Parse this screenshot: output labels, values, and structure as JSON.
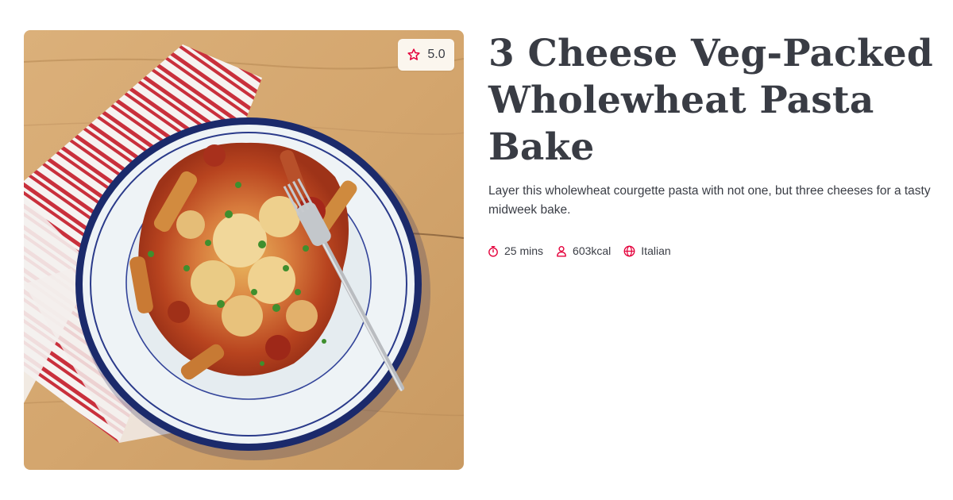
{
  "recipe": {
    "title": "3 Cheese Veg-Packed Wholewheat Pasta Bake",
    "description": "Layer this wholewheat courgette pasta with not one, but three cheeses for a tasty midweek bake.",
    "rating": "5.0",
    "image_alt": "3 Cheese Veg-Packed Wholewheat Pasta Bake",
    "meta": {
      "time": "25 mins",
      "calories": "603kcal",
      "cuisine": "Italian"
    }
  },
  "icons": {
    "rating": "star-icon",
    "time": "stopwatch-icon",
    "calories": "person-icon",
    "cuisine": "globe-icon"
  },
  "colors": {
    "accent": "#e4003b",
    "text": "#393c44",
    "badge_bg": "#fbf6ee"
  }
}
